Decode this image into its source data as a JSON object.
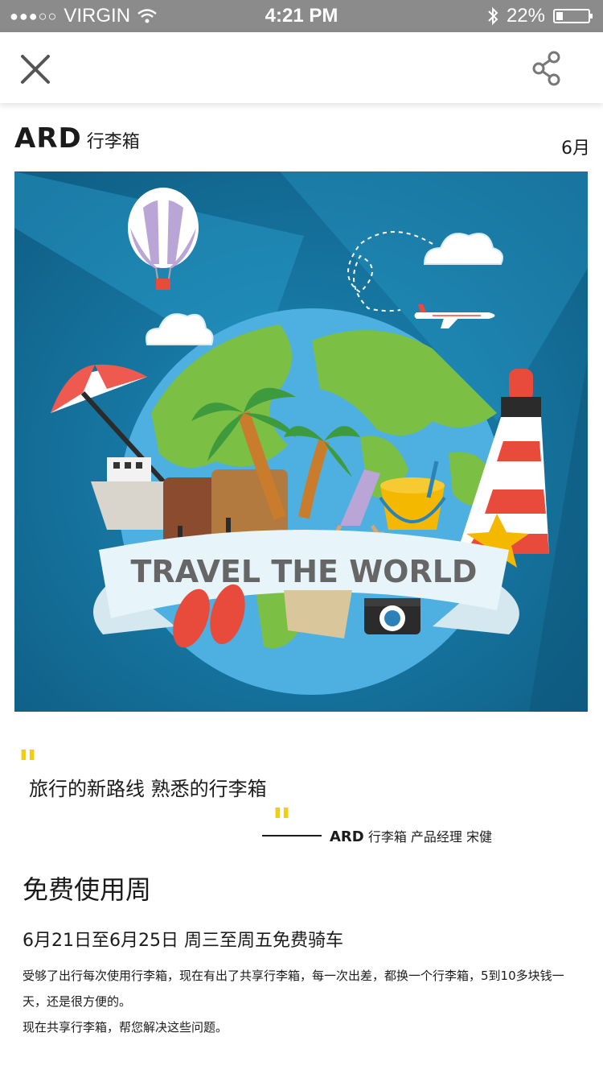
{
  "status": {
    "signal": "●●●○○",
    "carrier": "VIRGIN",
    "time": "4:21 PM",
    "battery": "22%",
    "battery_level": 0.22
  },
  "nav": {
    "close_icon": "close-icon",
    "share_icon": "share-icon"
  },
  "brand": {
    "name": "ARD",
    "subtitle": "行李箱",
    "month": "6月"
  },
  "hero": {
    "banner_text": "TRAVEL THE WORLD",
    "colors": {
      "background": "#17739a",
      "ocean": "#4db0e0",
      "land": "#7cbf45",
      "banner": "#e7f4f9",
      "banner_text": "#666666"
    }
  },
  "quote": {
    "text": "旅行的新路线 熟悉的行李箱",
    "author_brand": "ARD",
    "author_rest": "行李箱 产品经理 宋健",
    "mark_color": "#f5d000"
  },
  "section": {
    "title": "免费使用周",
    "subtitle": "6月21日至6月25日 周三至周五免费骑车",
    "paragraph1": "受够了出行每次使用行李箱，现在有出了共享行李箱，每一次出差，都换一个行李箱，5到10多块钱一天，还是很方便的。",
    "paragraph2": "现在共享行李箱，帮您解决这些问题。"
  }
}
